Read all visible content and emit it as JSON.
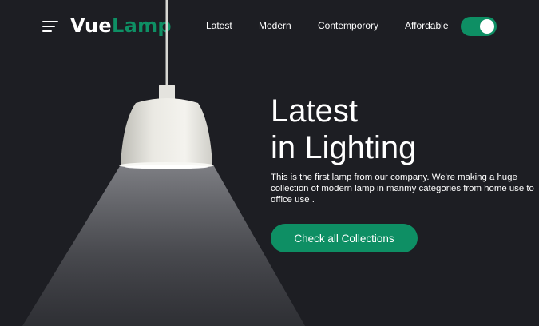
{
  "brand": {
    "logo_part1": "Vue",
    "logo_part2": "Lamp",
    "accent_color": "#0e8f64",
    "background_color": "#1d1e23"
  },
  "nav": {
    "menu_icon": "hamburger-menu-icon",
    "items": [
      {
        "label": "Latest"
      },
      {
        "label": "Modern"
      },
      {
        "label": "Contemporory"
      },
      {
        "label": "Affordable"
      }
    ],
    "theme_toggle": {
      "state": "on"
    }
  },
  "hero": {
    "title_line1": "Latest",
    "title_line2": "in Lighting",
    "description": "This is the first lamp from our company. We're making a huge collection of modern lamp in manmy categories from home use to office use .",
    "cta_label": "Check all Collections"
  }
}
